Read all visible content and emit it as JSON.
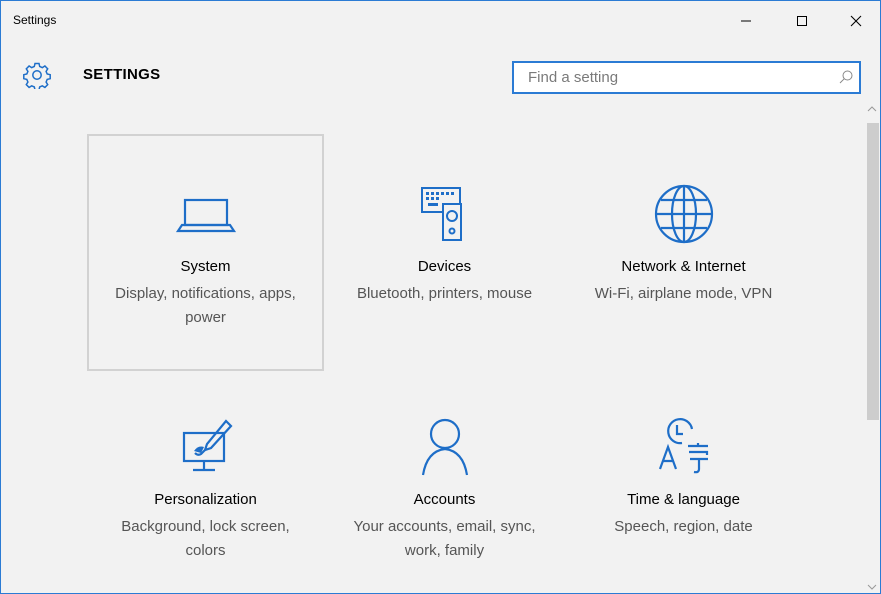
{
  "window": {
    "title": "Settings",
    "border_color": "#2b7bd4"
  },
  "header": {
    "title": "SETTINGS",
    "icon": "gear-icon"
  },
  "search": {
    "placeholder": "Find a setting",
    "value": "",
    "icon": "search-icon"
  },
  "accent_color": "#1e6ec8",
  "categories": [
    {
      "label": "System",
      "description": "Display, notifications, apps, power",
      "icon": "laptop-icon",
      "selected": true
    },
    {
      "label": "Devices",
      "description": "Bluetooth, printers, mouse",
      "icon": "devices-icon",
      "selected": false
    },
    {
      "label": "Network & Internet",
      "description": "Wi-Fi, airplane mode, VPN",
      "icon": "globe-icon",
      "selected": false
    },
    {
      "label": "Personalization",
      "description": "Background, lock screen, colors",
      "icon": "personalization-icon",
      "selected": false
    },
    {
      "label": "Accounts",
      "description": "Your accounts, email, sync, work, family",
      "icon": "person-icon",
      "selected": false
    },
    {
      "label": "Time & language",
      "description": "Speech, region, date",
      "icon": "time-language-icon",
      "selected": false
    }
  ]
}
